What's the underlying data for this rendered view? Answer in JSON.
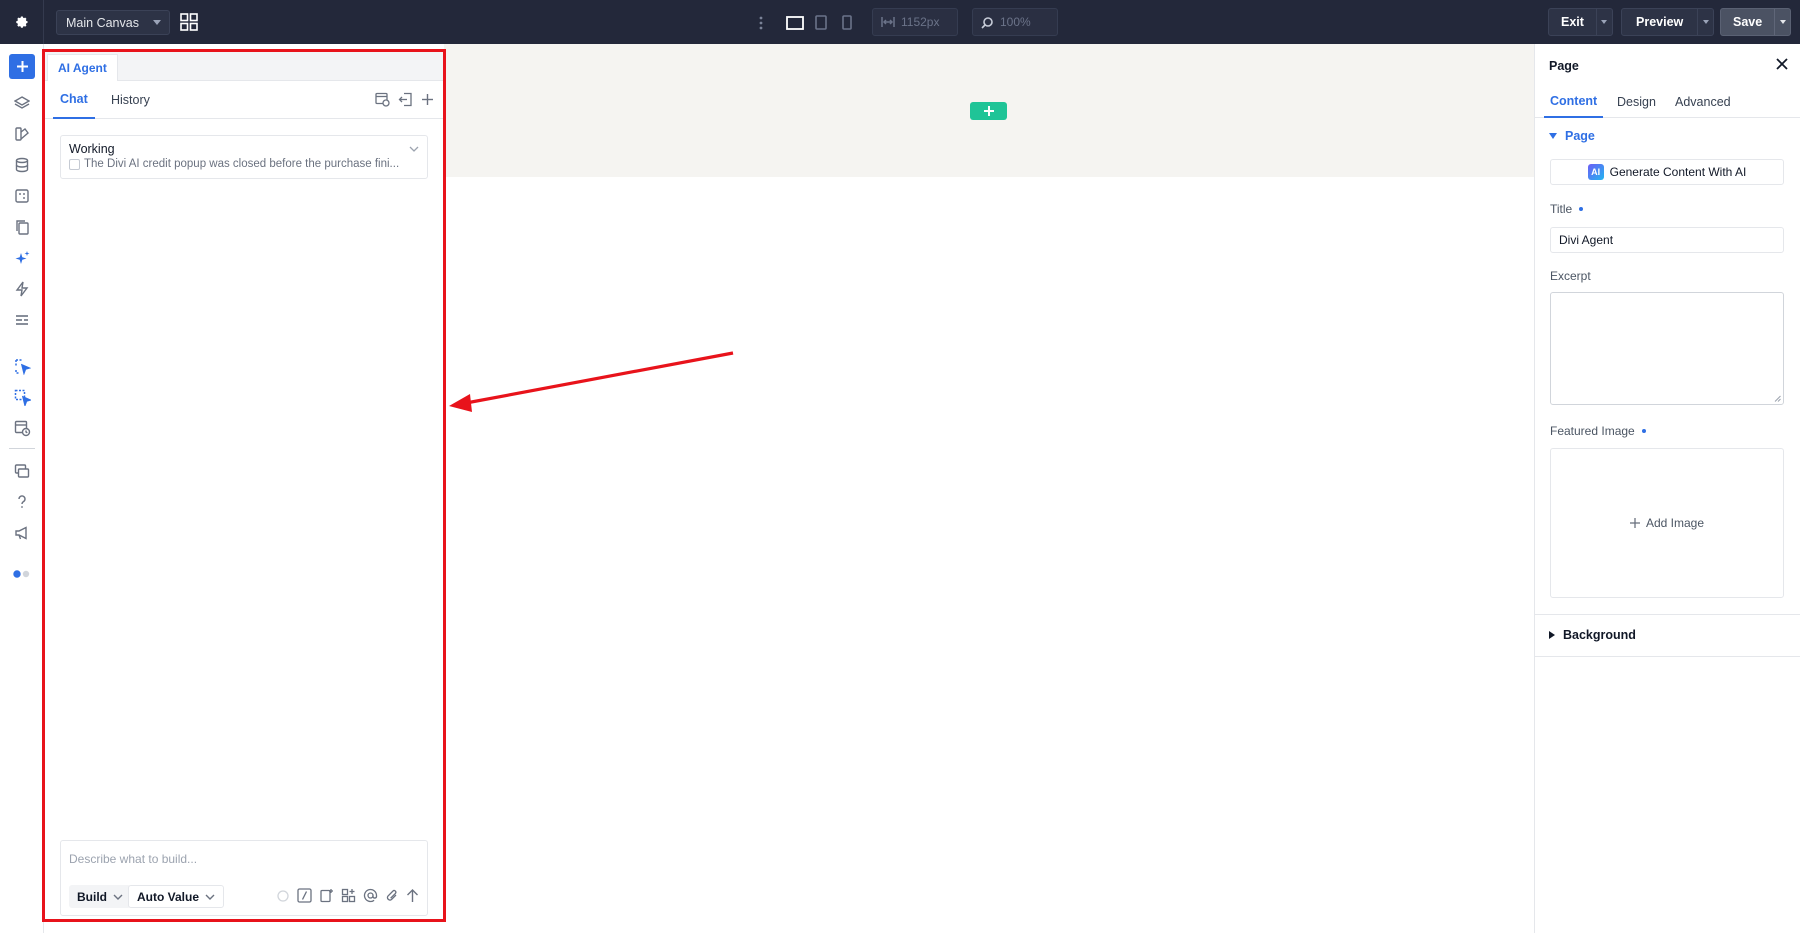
{
  "topbar": {
    "canvas_name": "Main Canvas",
    "width_value": "1152px",
    "zoom_value": "100%",
    "exit_label": "Exit",
    "preview_label": "Preview",
    "save_label": "Save"
  },
  "agent_panel": {
    "tab_label": "AI Agent",
    "subtabs": [
      "Chat",
      "History"
    ],
    "working_title": "Working",
    "working_detail": "The Divi AI credit popup was closed before the purchase fini...",
    "composer_placeholder": "Describe what to build...",
    "mode_label": "Build",
    "auto_label": "Auto Value"
  },
  "right_panel": {
    "title": "Page",
    "tabs": [
      "Content",
      "Design",
      "Advanced"
    ],
    "section_page": "Page",
    "ai_button_badge": "AI",
    "ai_button_label": "Generate Content With AI",
    "title_label": "Title",
    "title_value": "Divi Agent",
    "excerpt_label": "Excerpt",
    "featured_image_label": "Featured Image",
    "add_image_label": "Add Image",
    "section_background": "Background"
  },
  "colors": {
    "accent": "#2f6fe4",
    "topbar": "#23283a",
    "add_section": "#1fc497",
    "highlight": "#e8131b"
  }
}
